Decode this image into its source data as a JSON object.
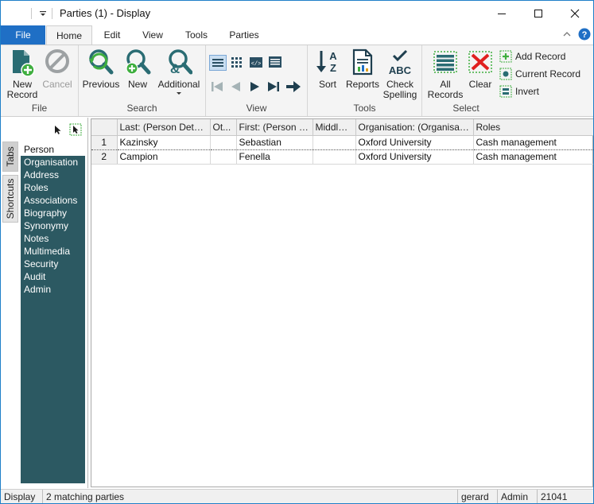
{
  "window": {
    "title": "Parties (1) - Display",
    "quick_access_icon": "dropdown-arrow-icon",
    "controls": [
      "minimize-icon",
      "maximize-icon",
      "close-icon"
    ]
  },
  "tabs": [
    {
      "label": "File"
    },
    {
      "label": "Home"
    },
    {
      "label": "Edit"
    },
    {
      "label": "View"
    },
    {
      "label": "Tools"
    },
    {
      "label": "Parties"
    }
  ],
  "ribbon": {
    "file_group": {
      "label": "File",
      "new_record": "New\nRecord",
      "cancel": "Cancel"
    },
    "search_group": {
      "label": "Search",
      "previous": "Previous",
      "new": "New",
      "additional": "Additional"
    },
    "view_group": {
      "label": "View"
    },
    "tools_group": {
      "label": "Tools",
      "sort": "Sort",
      "reports": "Reports",
      "check_spelling": "Check\nSpelling"
    },
    "select_group": {
      "label": "Select",
      "all_records": "All\nRecords",
      "clear": "Clear",
      "add_record": "Add Record",
      "current_record": "Current Record",
      "invert": "Invert"
    }
  },
  "side_tabs": [
    "Tabs",
    "Shortcuts"
  ],
  "nav_items": [
    "Person",
    "Organisation",
    "Address",
    "Roles",
    "Associations",
    "Biography",
    "Synonymy",
    "Notes",
    "Multimedia",
    "Security",
    "Audit",
    "Admin"
  ],
  "grid": {
    "columns": [
      "Last: (Person Details)",
      "Ot...",
      "First: (Person D...",
      "Middle: ...",
      "Organisation: (Organisatio...",
      "Roles"
    ],
    "rows": [
      {
        "num": "1",
        "cells": [
          "Kazinsky",
          "",
          "Sebastian",
          "",
          "Oxford University",
          "Cash management"
        ]
      },
      {
        "num": "2",
        "cells": [
          "Campion",
          "",
          "Fenella",
          "",
          "Oxford University",
          "Cash management"
        ]
      }
    ]
  },
  "status": {
    "mode": "Display",
    "count": "2 matching parties",
    "user": "gerard",
    "role": "Admin",
    "id": "21041"
  },
  "colors": {
    "accent": "#1f6fc5",
    "nav_bg": "#2c5962",
    "icon_teal": "#2a6c73",
    "icon_green": "#3fae3f",
    "clear_red": "#e02020"
  }
}
